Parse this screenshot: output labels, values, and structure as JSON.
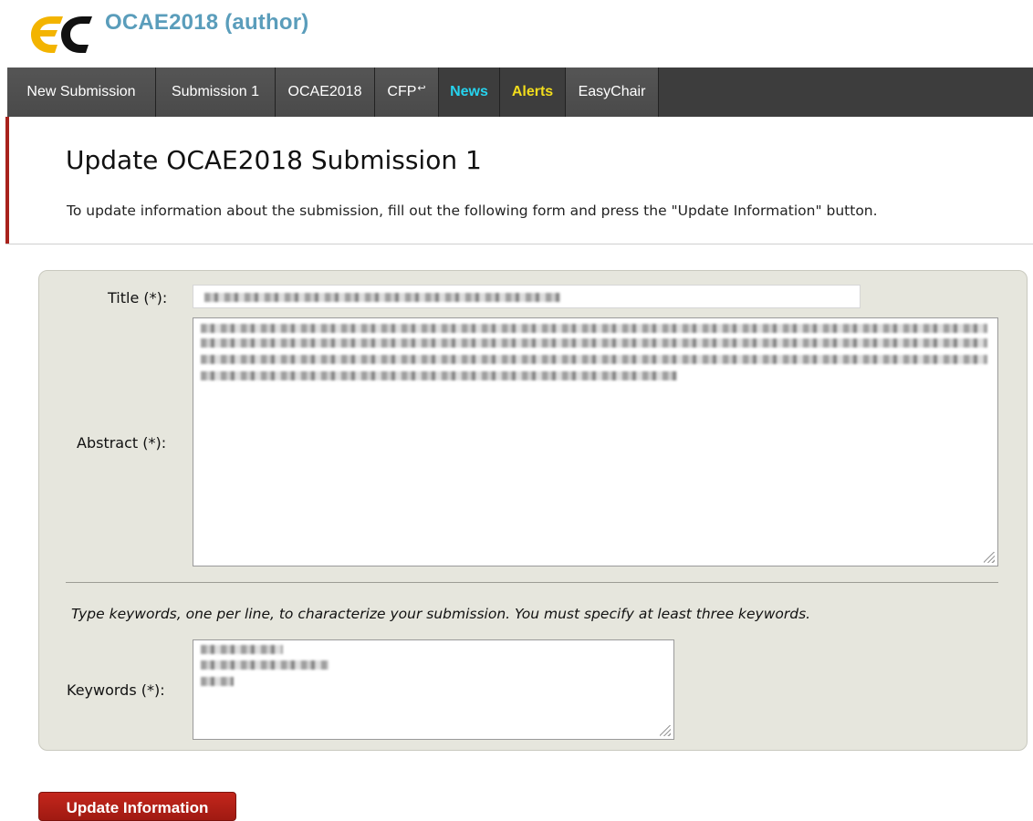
{
  "header": {
    "app_title": "OCAE2018 (author)",
    "logo_colors": {
      "e": "#f3b400",
      "c": "#111111"
    }
  },
  "nav": {
    "items": [
      {
        "label": "New Submission"
      },
      {
        "label": "Submission 1"
      },
      {
        "label": "OCAE2018"
      },
      {
        "label": "CFP"
      },
      {
        "label": "News",
        "color": "#26d3ee"
      },
      {
        "label": "Alerts",
        "color": "#f2dd1c"
      },
      {
        "label": "EasyChair"
      }
    ]
  },
  "page": {
    "title": "Update OCAE2018 Submission 1",
    "intro": "To update information about the submission, fill out the following form and press the \"Update Information\" button."
  },
  "form": {
    "title_label": "Title (*):",
    "abstract_label": "Abstract (*):",
    "keywords_hint": "Type keywords, one per line, to characterize your submission. You must specify at least three keywords.",
    "keywords_label": "Keywords (*):",
    "title_value_redacted": true,
    "abstract_value_redacted": true,
    "keywords_value_redacted": true
  },
  "actions": {
    "update_label": "Update Information"
  },
  "colors": {
    "accent_red": "#a8221c",
    "brand_blue": "#5a9dbb",
    "nav_bg": "#3d3d3d",
    "panel_bg": "#e6e6dd"
  }
}
